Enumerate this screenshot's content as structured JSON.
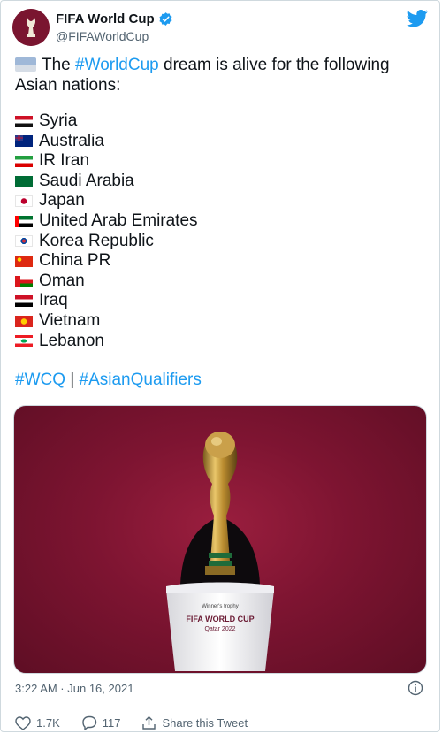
{
  "account": {
    "name": "FIFA World Cup",
    "handle": "@FIFAWorldCup"
  },
  "tweet": {
    "intro_prefix": "The ",
    "intro_hashtag": "#WorldCup",
    "intro_suffix": " dream is alive for the following Asian nations:",
    "countries": [
      "Syria",
      "Australia",
      "IR Iran",
      "Saudi Arabia",
      "Japan",
      "United Arab Emirates",
      "Korea Republic",
      "China PR",
      "Oman",
      "Iraq",
      "Vietnam",
      "Lebanon"
    ],
    "hashtag_1": "#WCQ",
    "hashtag_separator": "|",
    "hashtag_2": "#AsianQualifiers",
    "media": {
      "trophy_plate_line1": "Winner's trophy",
      "trophy_plate_line2": "FIFA WORLD CUP",
      "trophy_plate_line3": "Qatar 2022"
    },
    "timestamp": "3:22 AM · Jun 16, 2021"
  },
  "actions": {
    "likes": "1.7K",
    "replies": "117",
    "share_label": "Share this Tweet"
  },
  "colors": {
    "link": "#1d9bf0",
    "muted": "#536471",
    "media_background": "#7d1431"
  },
  "icons": [
    "fifa-logo-icon",
    "verified-badge-icon",
    "twitter-bird-icon",
    "info-icon",
    "heart-icon",
    "reply-icon",
    "share-icon",
    "flag-icon"
  ]
}
